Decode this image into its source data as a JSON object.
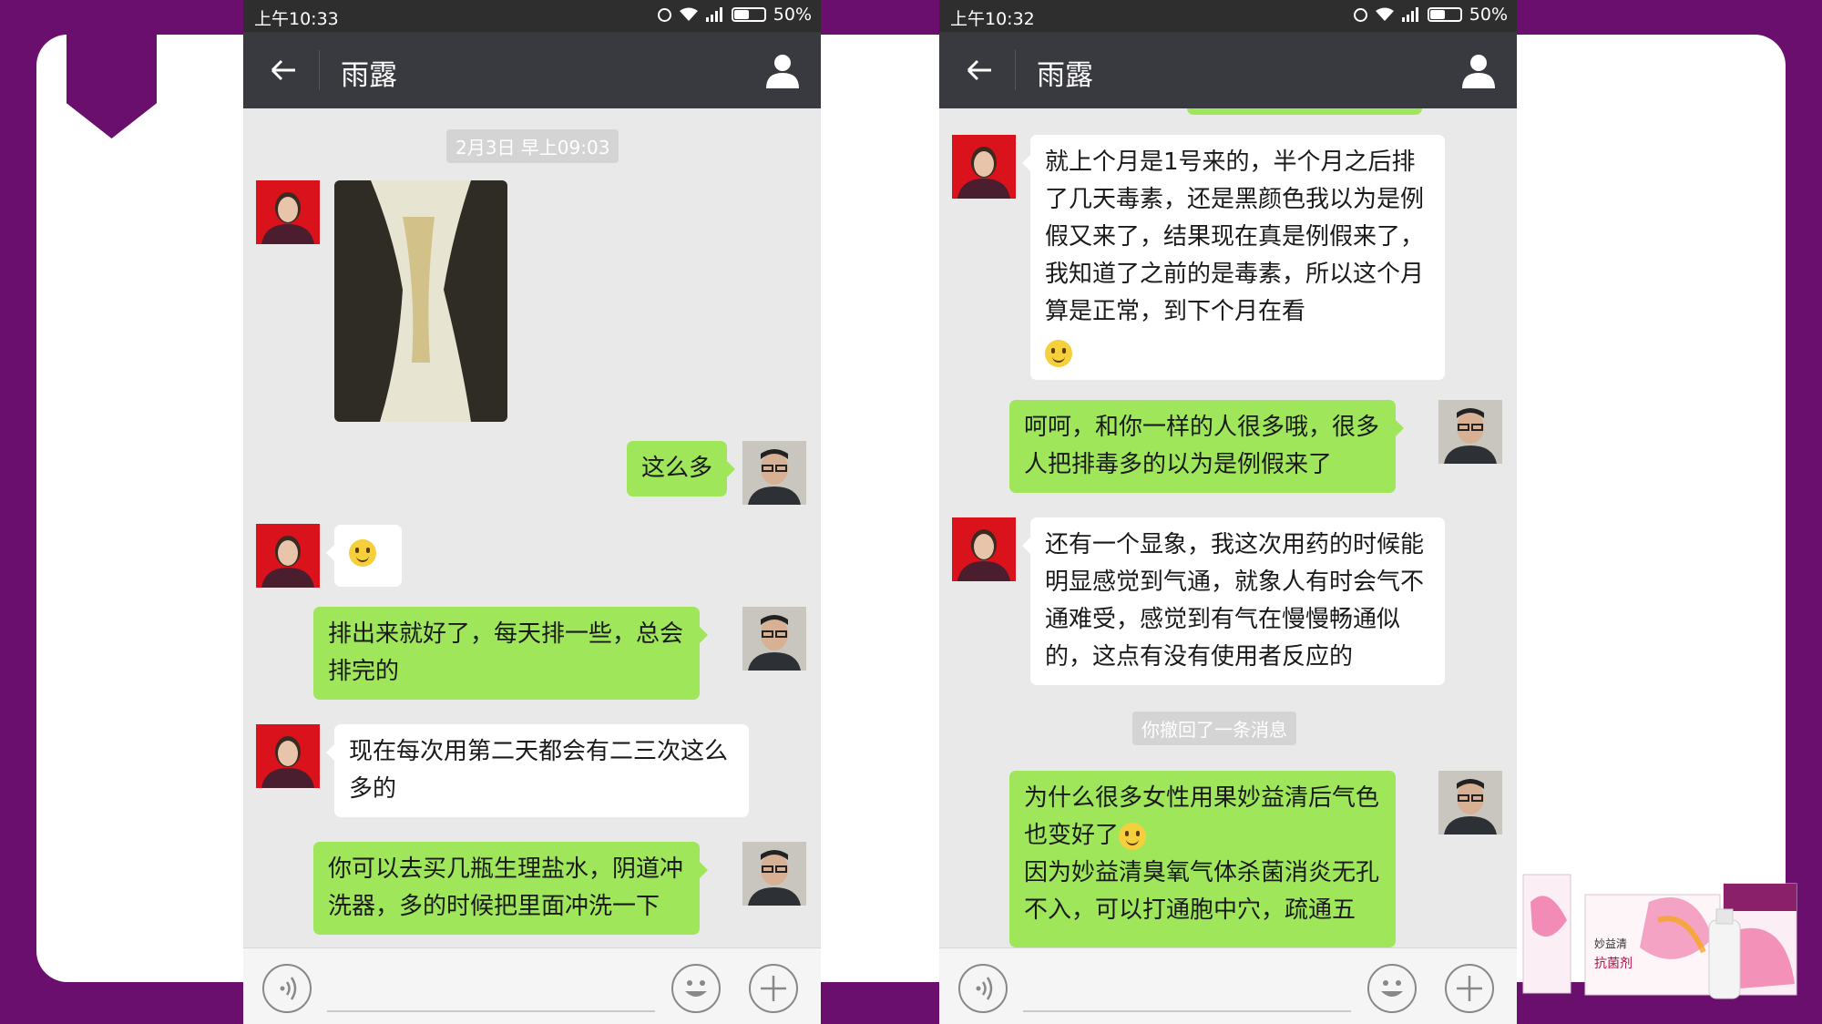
{
  "left_phone": {
    "status": {
      "time": "上午10:33",
      "battery": "50%"
    },
    "contact_name": "雨露",
    "timestamp": "2月3日 早上09:03",
    "messages": [
      {
        "side": "in",
        "type": "image"
      },
      {
        "side": "out",
        "text": "这么多"
      },
      {
        "side": "in",
        "type": "emoji"
      },
      {
        "side": "out",
        "text": "排出来就好了，每天排一些，总会排完的"
      },
      {
        "side": "in",
        "text": "现在每次用第二天都会有二三次这么多的"
      },
      {
        "side": "out",
        "text": "你可以去买几瓶生理盐水，阴道冲洗器，多的时候把里面冲洗一下"
      }
    ]
  },
  "right_phone": {
    "status": {
      "time": "上午10:32",
      "battery": "50%"
    },
    "contact_name": "雨露",
    "recall_notice": "你撤回了一条消息",
    "messages": [
      {
        "side": "in",
        "text": "就上个月是1号来的，半个月之后排了几天毒素，还是黑颜色我以为是例假又来了，结果现在真是例假来了，我知道了之前的是毒素，所以这个月算是正常，到下个月在看"
      },
      {
        "side": "out",
        "text": "呵呵，和你一样的人很多哦，很多人把排毒多的以为是例假来了"
      },
      {
        "side": "in",
        "text": "还有一个显象，我这次用药的时候能明显感觉到气通，就象人有时会气不通难受，感觉到有气在慢慢畅通似的，这点有没有使用者反应的"
      },
      {
        "side": "out",
        "text_a": "为什么很多女性用果妙益清后气色也变好了",
        "text_b": "因为妙益清臭氧气体杀菌消炎无孔不入，可以打通胞中穴，疏通五"
      }
    ]
  },
  "product_labels": [
    "妙益清",
    "抗菌剂"
  ],
  "icons": [
    "back-arrow-icon",
    "profile-icon",
    "voice-icon",
    "emoji-icon",
    "plus-icon",
    "wifi-icon",
    "signal-icon",
    "alarm-icon",
    "battery-icon"
  ],
  "colors": {
    "background": "#6a0f6e",
    "nav": "#393a3f",
    "status": "#2e2e2e",
    "bubble_out": "#9fe65b",
    "chat_bg": "#e9e9e9"
  }
}
